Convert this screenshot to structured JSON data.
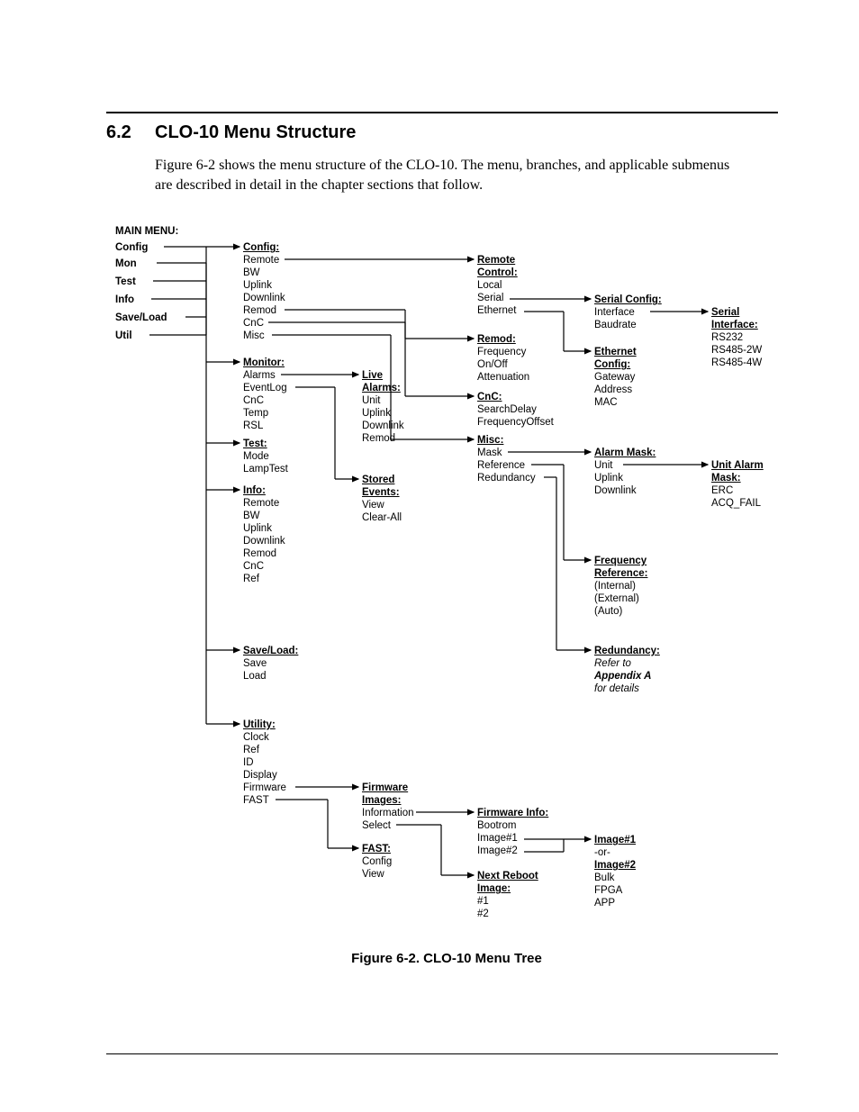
{
  "section": {
    "number": "6.2",
    "title": "CLO-10 Menu Structure"
  },
  "para": "Figure 6-2 shows the menu structure of the CLO-10. The menu, branches, and applicable submenus are described in detail in the chapter sections that follow.",
  "caption": "Figure 6-2. CLO-10 Menu Tree",
  "main_menu_label": "MAIN MENU:",
  "main": [
    "Config",
    "Mon",
    "Test",
    "Info",
    "Save/Load",
    "Util"
  ],
  "col2": {
    "config": {
      "title": "Config:",
      "items": [
        "Remote",
        "BW",
        "Uplink",
        "Downlink",
        "Remod",
        "CnC",
        "Misc"
      ]
    },
    "monitor": {
      "title": "Monitor:",
      "items": [
        "Alarms",
        "EventLog",
        "CnC",
        "Temp",
        "RSL"
      ]
    },
    "test": {
      "title": "Test:",
      "items": [
        "Mode",
        "LampTest"
      ]
    },
    "info": {
      "title": "Info:",
      "items": [
        "Remote",
        "BW",
        "Uplink",
        "Downlink",
        "Remod",
        "CnC",
        "Ref"
      ]
    },
    "saveload": {
      "title": "Save/Load:",
      "items": [
        "Save",
        "Load"
      ]
    },
    "utility": {
      "title": "Utility:",
      "items": [
        "Clock",
        "Ref",
        "ID",
        "Display",
        "Firmware",
        "FAST"
      ]
    }
  },
  "col3": {
    "live": {
      "title": "Live",
      "sub": "Alarms:",
      "items": [
        "Unit",
        "Uplink",
        "Downlink",
        "Remod"
      ]
    },
    "stored": {
      "title": "Stored",
      "sub": "Events:",
      "items": [
        "View",
        "Clear-All"
      ]
    },
    "firmware": {
      "title": "Firmware",
      "sub": "Images:",
      "items": [
        "Information",
        "Select"
      ]
    },
    "fast": {
      "title": "FAST:",
      "items": [
        "Config",
        "View"
      ]
    }
  },
  "col4": {
    "remote": {
      "title": "Remote",
      "sub": "Control:",
      "items": [
        "Local",
        "Serial",
        "Ethernet"
      ]
    },
    "remod": {
      "title": "Remod:",
      "items": [
        "Frequency",
        "On/Off",
        "Attenuation"
      ]
    },
    "cnc": {
      "title": "CnC:",
      "items": [
        "SearchDelay",
        "FrequencyOffset"
      ]
    },
    "misc": {
      "title": "Misc:",
      "items": [
        "Mask",
        "Reference",
        "Redundancy"
      ]
    },
    "fwinfo": {
      "title": "Firmware Info:",
      "items": [
        "Bootrom",
        "Image#1",
        "Image#2"
      ]
    },
    "nextreboot": {
      "title": "Next Reboot",
      "sub": "Image:",
      "items": [
        "#1",
        "#2"
      ]
    }
  },
  "col5": {
    "serial": {
      "title": "Serial Config:",
      "items": [
        "Interface",
        "Baudrate"
      ]
    },
    "ethernet": {
      "title": "Ethernet",
      "sub": "Config:",
      "items": [
        "Gateway",
        "Address",
        "MAC"
      ]
    },
    "alarmmask": {
      "title": "Alarm Mask:",
      "items": [
        "Unit",
        "Uplink",
        "Downlink"
      ]
    },
    "freqref": {
      "title": "Frequency",
      "sub": "Reference:",
      "items": [
        "(Internal)",
        "(External)",
        "(Auto)"
      ]
    },
    "redund": {
      "title": "Redundancy:",
      "items_i": [
        "Refer to",
        "Appendix A",
        "for details"
      ]
    },
    "image1": {
      "title": "Image#1",
      "or": "-or-",
      "title2": "Image#2",
      "items": [
        "Bulk",
        "FPGA",
        "APP"
      ]
    }
  },
  "col6": {
    "serial": {
      "title": "Serial",
      "sub": "Interface:",
      "items": [
        "RS232",
        "RS485-2W",
        "RS485-4W"
      ]
    },
    "unitalarm": {
      "title": "Unit Alarm",
      "sub": "Mask:",
      "items": [
        "ERC",
        "ACQ_FAIL"
      ]
    }
  }
}
